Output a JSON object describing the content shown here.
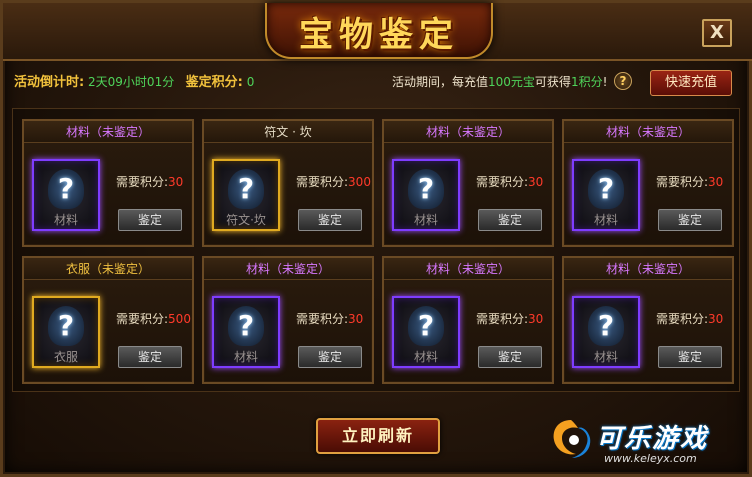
{
  "window": {
    "title": "宝物鉴定",
    "close_label": "X"
  },
  "header": {
    "countdown_label": "活动倒计时:",
    "countdown_value": "2天09小时01分",
    "score_label": "鉴定积分:",
    "score_value": "0",
    "notice_prefix": "活动期间，每充值",
    "notice_amount": "100元宝",
    "notice_mid": "可获得",
    "notice_points": "1积分",
    "notice_suffix": "!",
    "help_symbol": "?",
    "recharge_label": "快速充值"
  },
  "cards": [
    {
      "title": "材料（未鉴定）",
      "quality": "purple",
      "slot_label": "材料",
      "req_label": "需要积分:",
      "req_value": "30",
      "button": "鉴定"
    },
    {
      "title": "符文 · 坎",
      "quality": "gold",
      "slot_label": "符文·坎",
      "req_label": "需要积分:",
      "req_value": "300",
      "button": "鉴定"
    },
    {
      "title": "材料（未鉴定）",
      "quality": "purple",
      "slot_label": "材料",
      "req_label": "需要积分:",
      "req_value": "30",
      "button": "鉴定"
    },
    {
      "title": "材料（未鉴定）",
      "quality": "purple",
      "slot_label": "材料",
      "req_label": "需要积分:",
      "req_value": "30",
      "button": "鉴定"
    },
    {
      "title": "衣服（未鉴定）",
      "quality": "gold",
      "slot_label": "衣服",
      "req_label": "需要积分:",
      "req_value": "500",
      "button": "鉴定"
    },
    {
      "title": "材料（未鉴定）",
      "quality": "purple",
      "slot_label": "材料",
      "req_label": "需要积分:",
      "req_value": "30",
      "button": "鉴定"
    },
    {
      "title": "材料（未鉴定）",
      "quality": "purple",
      "slot_label": "材料",
      "req_label": "需要积分:",
      "req_value": "30",
      "button": "鉴定"
    },
    {
      "title": "材料（未鉴定）",
      "quality": "purple",
      "slot_label": "材料",
      "req_label": "需要积分:",
      "req_value": "30",
      "button": "鉴定"
    }
  ],
  "question_mark": "?",
  "footer": {
    "refresh_label": "立即刷新"
  },
  "watermark": {
    "name": "可乐游戏",
    "url": "www.keleyx.com"
  },
  "colors": {
    "purple_quality": "#7e3cff",
    "gold_quality": "#e0aa20",
    "required_points": "#ff3a2a",
    "highlight_green": "#4fd45a"
  }
}
